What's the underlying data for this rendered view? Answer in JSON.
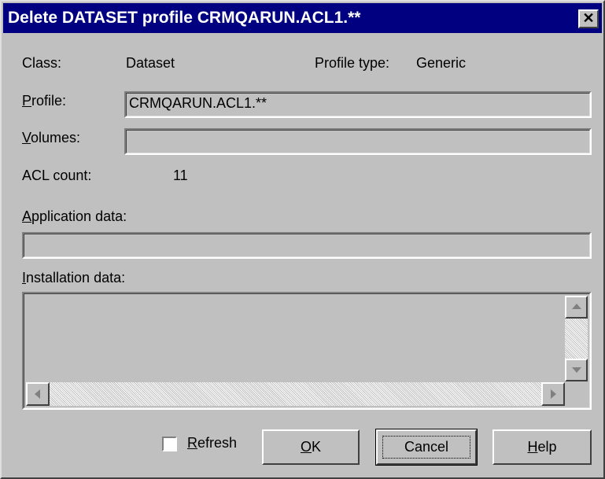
{
  "window": {
    "title": "Delete DATASET profile CRMQARUN.ACL1.**"
  },
  "fields": {
    "class_label": "Class:",
    "class_value": "Dataset",
    "profile_type_label": "Profile type:",
    "profile_type_value": "Generic",
    "profile_label_accel": "P",
    "profile_label_rest": "rofile:",
    "profile_value": "CRMQARUN.ACL1.**",
    "volumes_label_accel": "V",
    "volumes_label_rest": "olumes:",
    "volumes_value": "",
    "acl_count_label": "ACL count:",
    "acl_count_value": "11",
    "application_data_label_accel": "A",
    "application_data_label_rest": "pplication data:",
    "application_data_value": "",
    "installation_data_label_accel": "I",
    "installation_data_label_rest": "nstallation data:",
    "installation_data_value": ""
  },
  "buttons": {
    "refresh_accel": "R",
    "refresh_rest": "efresh",
    "refresh_checked": false,
    "ok_accel": "O",
    "ok_rest": "K",
    "cancel": "Cancel",
    "help_accel": "H",
    "help_rest": "elp"
  },
  "icons": {
    "close": "close-icon",
    "scroll_up": "arrow-up-icon",
    "scroll_down": "arrow-down-icon",
    "scroll_left": "arrow-left-icon",
    "scroll_right": "arrow-right-icon"
  }
}
